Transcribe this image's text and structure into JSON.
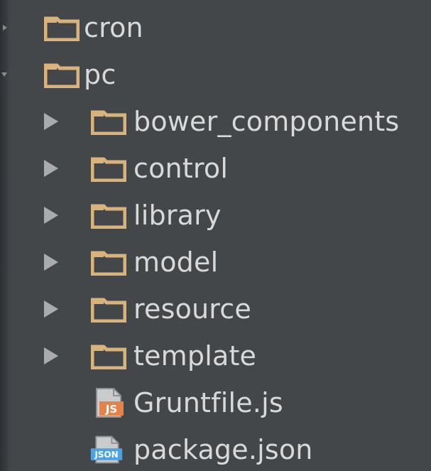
{
  "colors": {
    "background": "#44474a",
    "folder": "#d9b37a",
    "text": "#d9d9d9",
    "arrow": "#a9abad",
    "js_badge": "#e4824a",
    "json_badge": "#4aa3e6"
  },
  "tree": {
    "items": [
      {
        "label": "cron",
        "type": "folder",
        "icon": "folder-icon",
        "state": "collapsed"
      },
      {
        "label": "pc",
        "type": "folder",
        "icon": "folder-icon",
        "state": "expanded"
      },
      {
        "label": "bower_components",
        "type": "folder",
        "icon": "folder-icon",
        "state": "collapsed"
      },
      {
        "label": "control",
        "type": "folder",
        "icon": "folder-icon",
        "state": "collapsed"
      },
      {
        "label": "library",
        "type": "folder",
        "icon": "folder-icon",
        "state": "collapsed"
      },
      {
        "label": "model",
        "type": "folder",
        "icon": "folder-icon",
        "state": "collapsed"
      },
      {
        "label": "resource",
        "type": "folder",
        "icon": "folder-icon",
        "state": "collapsed"
      },
      {
        "label": "template",
        "type": "folder",
        "icon": "folder-icon",
        "state": "collapsed"
      },
      {
        "label": "Gruntfile.js",
        "type": "file",
        "icon": "js-file-icon",
        "badge": "JS"
      },
      {
        "label": "package.json",
        "type": "file",
        "icon": "json-file-icon",
        "badge": "JSON"
      }
    ]
  }
}
